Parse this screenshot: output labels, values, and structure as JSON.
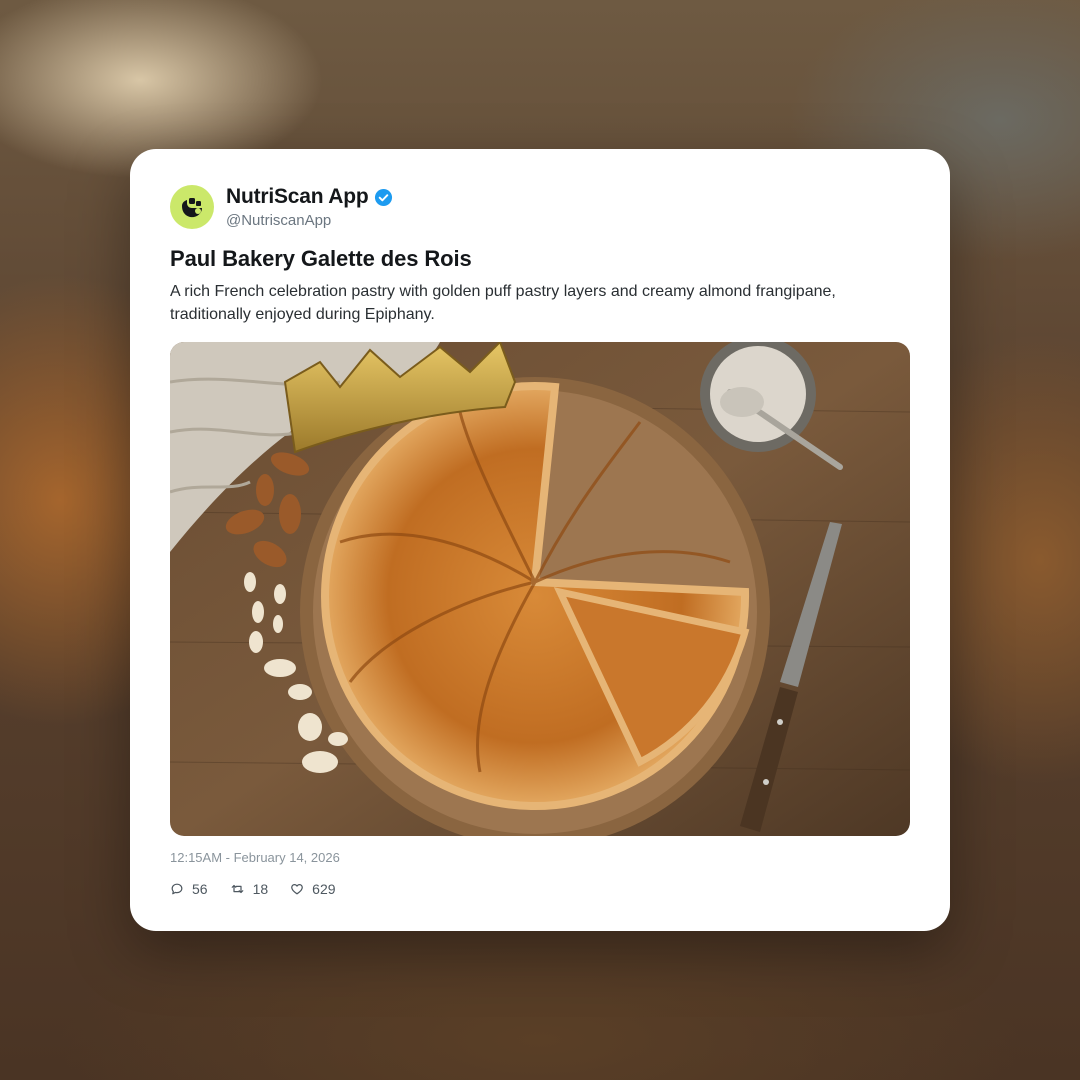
{
  "post": {
    "display_name": "NutriScan App",
    "handle": "@NutriscanApp",
    "title": "Paul Bakery Galette des Rois",
    "description": "A rich French celebration pastry with golden puff pastry layers and creamy almond frangipane, traditionally enjoyed during Epiphany.",
    "timestamp": "12:15AM - February 14, 2026",
    "stats": {
      "replies": "56",
      "retweets": "18",
      "likes": "629"
    }
  },
  "icons": {
    "avatar": "nutriscan-logo-icon",
    "verified": "verified-badge-icon",
    "reply": "comment-icon",
    "retweet": "retweet-icon",
    "like": "heart-icon"
  },
  "colors": {
    "avatar_bg": "#cbe86a",
    "verified": "#1d9bf0",
    "card_bg": "#ffffff",
    "text_primary": "#14171a",
    "text_muted": "#8a949c"
  }
}
